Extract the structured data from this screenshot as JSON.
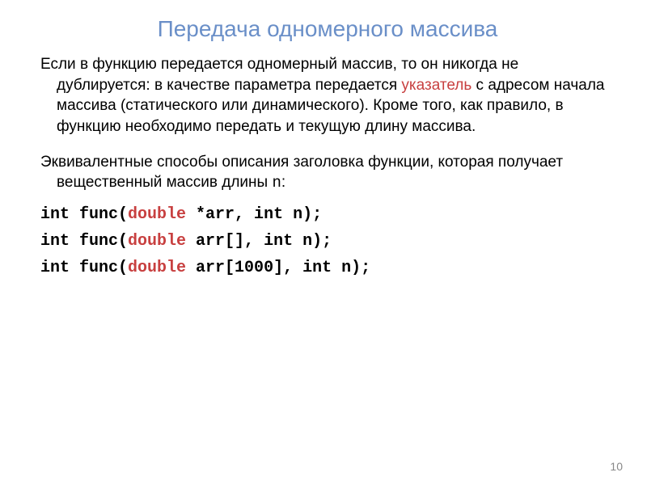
{
  "title": "Передача одномерного массива",
  "paragraph1_part1": "Если в функцию передается одномерный массив, то он никогда не дублируется: в качестве параметра передается ",
  "paragraph1_keyword": "указатель",
  "paragraph1_part2": " с адресом начала массива (статического или динамического). Кроме того, как правило, в функцию необходимо передать и текущую длину массива.",
  "paragraph2_part1": "Эквивалентные способы описания заголовка функции, которая получает вещественный массив  длины ",
  "paragraph2_mono": "n",
  "paragraph2_part2": ":",
  "code_lines": [
    {
      "t1": "int func(",
      "kw": "double",
      "t2": " *arr, int n);"
    },
    {
      "t1": "int func(",
      "kw": "double",
      "t2": " arr[], int n);"
    },
    {
      "t1": "int func(",
      "kw": "double",
      "t2": " arr[1000], int n);"
    }
  ],
  "page_number": "10"
}
